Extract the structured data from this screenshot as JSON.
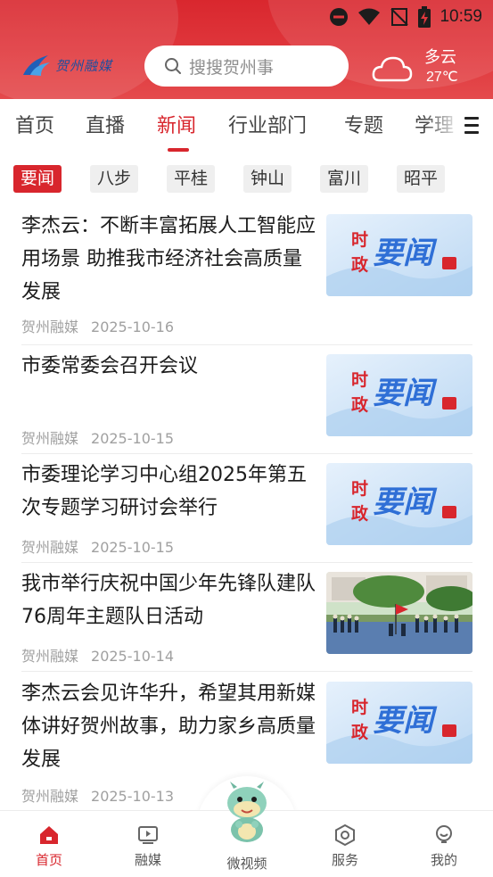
{
  "status_bar": {
    "time": "10:59"
  },
  "header": {
    "logo_text": "贺州融媒",
    "search_placeholder": "搜搜贺州事",
    "weather": {
      "condition": "多云",
      "temperature": "27℃"
    }
  },
  "channel_tabs": [
    {
      "label": "首页"
    },
    {
      "label": "直播"
    },
    {
      "label": "新闻",
      "active": true
    },
    {
      "label": "行业部门"
    },
    {
      "label": "专题"
    },
    {
      "label": "学理"
    }
  ],
  "region_tabs": [
    {
      "label": "要闻",
      "active": true
    },
    {
      "label": "八步"
    },
    {
      "label": "平桂"
    },
    {
      "label": "钟山"
    },
    {
      "label": "富川"
    },
    {
      "label": "昭平"
    }
  ],
  "news": [
    {
      "title": "李杰云：不断丰富拓展人工智能应用场景 助推我市经济社会高质量发展",
      "source": "贺州融媒",
      "date": "2025-10-16",
      "thumb": "时政要闻"
    },
    {
      "title": "市委常委会召开会议",
      "source": "贺州融媒",
      "date": "2025-10-15",
      "thumb": "时政要闻"
    },
    {
      "title": "市委理论学习中心组2025年第五次专题学习研讨会举行",
      "source": "贺州融媒",
      "date": "2025-10-15",
      "thumb": "时政要闻"
    },
    {
      "title": "我市举行庆祝中国少年先锋队建队76周年主题队日活动",
      "source": "贺州融媒",
      "date": "2025-10-14",
      "thumb": "photo"
    },
    {
      "title": "李杰云会见许华升，希望其用新媒体讲好贺州故事，助力家乡高质量发展",
      "source": "贺州融媒",
      "date": "2025-10-13",
      "thumb": "时政要闻"
    }
  ],
  "thumb_text": {
    "line1a": "时",
    "line1b": "政",
    "big": "要闻"
  },
  "bottom_nav": [
    {
      "label": "首页",
      "icon": "home-icon",
      "active": true
    },
    {
      "label": "融媒",
      "icon": "media-icon"
    },
    {
      "label": "微视频",
      "icon": "mascot-icon"
    },
    {
      "label": "服务",
      "icon": "service-icon"
    },
    {
      "label": "我的",
      "icon": "profile-icon"
    }
  ],
  "colors": {
    "brand_red": "#d8262d",
    "header_red": "#e0383d",
    "thumb_blue": "#2f6fd6"
  }
}
